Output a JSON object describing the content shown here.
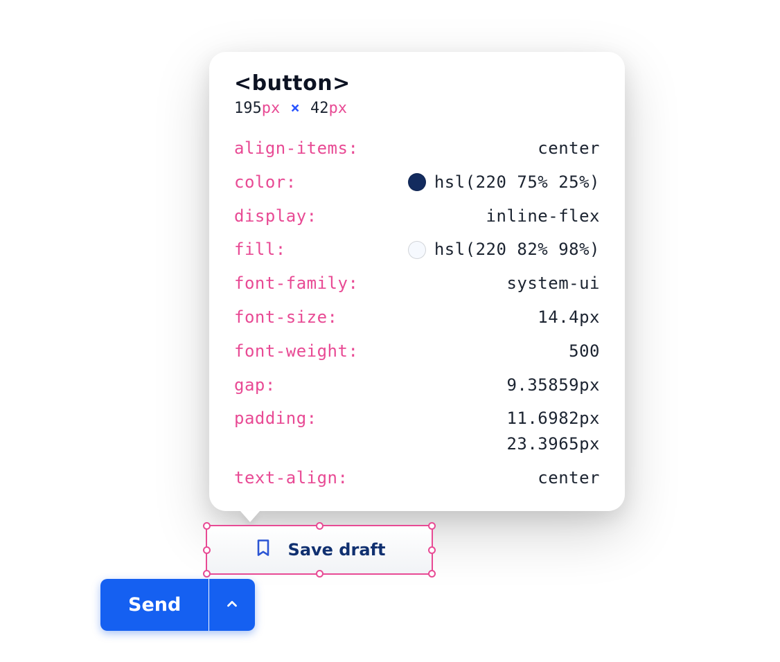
{
  "inspector": {
    "tag": "<button>",
    "width": "195",
    "height": "42",
    "unit": "px",
    "times": "×",
    "properties": [
      {
        "name": "align-items",
        "value": "center"
      },
      {
        "name": "color",
        "value": "hsl(220 75% 25%)",
        "swatch": "#132b5e"
      },
      {
        "name": "display",
        "value": "inline-flex"
      },
      {
        "name": "fill",
        "value": "hsl(220 82% 98%)",
        "swatch": "#f6f9fe"
      },
      {
        "name": "font-family",
        "value": "system-ui"
      },
      {
        "name": "font-size",
        "value": "14.4px"
      },
      {
        "name": "font-weight",
        "value": "500"
      },
      {
        "name": "gap",
        "value": "9.35859px"
      },
      {
        "name": "padding",
        "value": "11.6982px",
        "value2": "23.3965px"
      },
      {
        "name": "text-align",
        "value": "center"
      }
    ]
  },
  "selected_button": {
    "label": "Save draft",
    "icon": "bookmark"
  },
  "send_button": {
    "label": "Send",
    "icon": "chevron-up"
  }
}
